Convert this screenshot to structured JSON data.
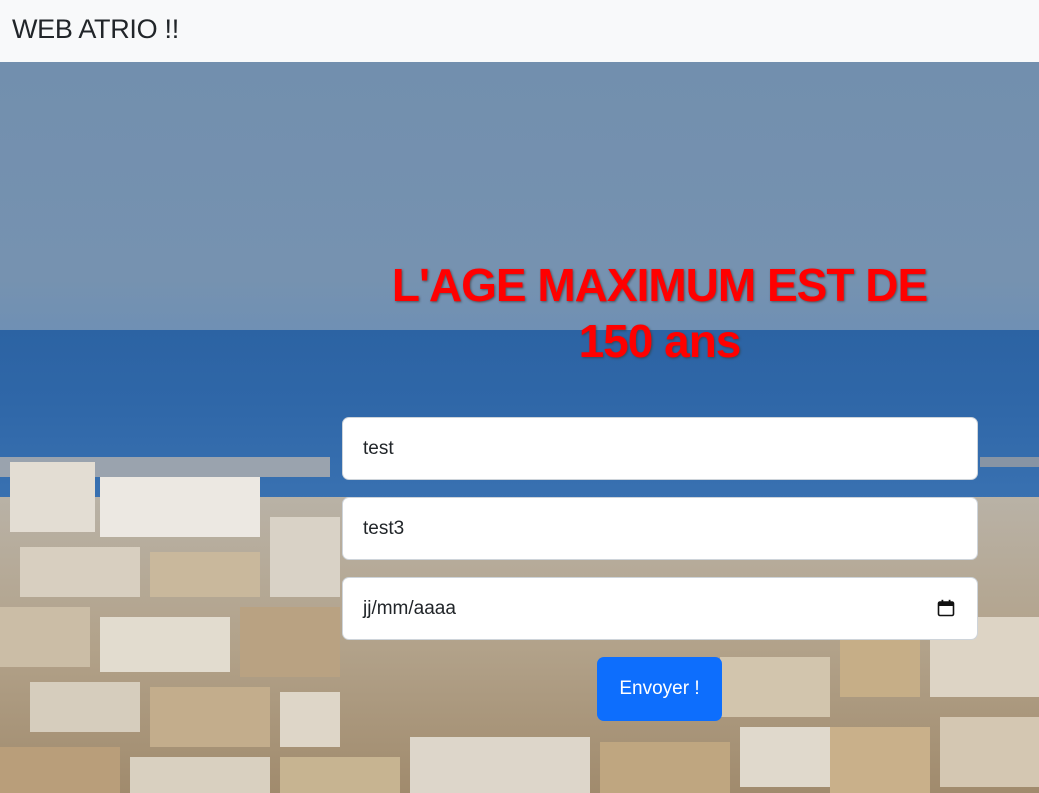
{
  "navbar": {
    "brand": "WEB ATRIO !!"
  },
  "hero": {
    "title_line1": "L'AGE MAXIMUM EST DE",
    "title_line2": "150 ans",
    "title_color": "#ff0000"
  },
  "form": {
    "field1_value": "test",
    "field2_value": "test3",
    "date_placeholder": "jj/mm/aaaa",
    "date_icon": "calendar-icon",
    "submit_label": "Envoyer !",
    "submit_color": "#0d6efd"
  }
}
